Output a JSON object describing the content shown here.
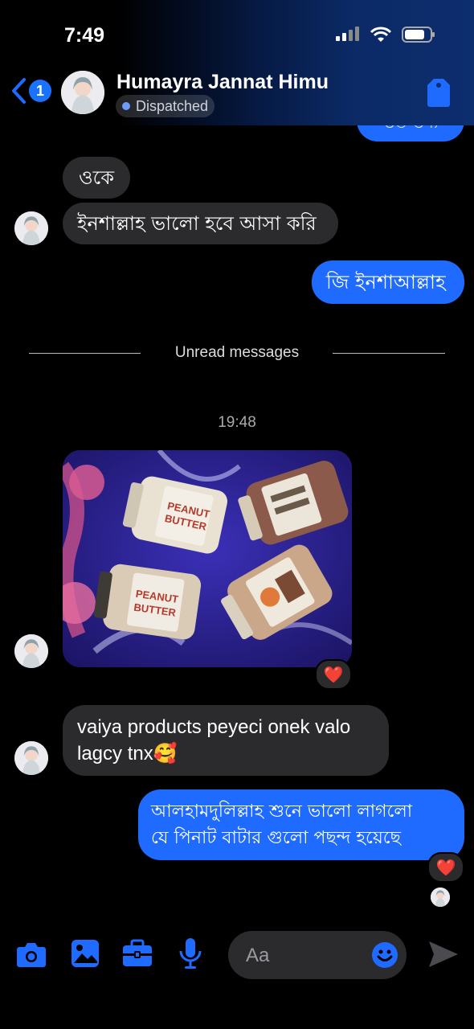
{
  "status": {
    "time": "7:49"
  },
  "header": {
    "back_count": "1",
    "contact_name": "Humayra Jannat Himu",
    "status_label": "Dispatched"
  },
  "messages": {
    "partial_top": "ভত ভন্য",
    "m1": "ওকে",
    "m2": "ইনশাল্লাহ ভালো হবে আসা করি",
    "m3": "জি ইনশাআল্লাহ",
    "unread_label": "Unread messages",
    "timestamp": "19:48",
    "m5_line1": "vaiya products peyeci onek valo",
    "m5_line2": "lagcy tnx🥰",
    "m6_line1": "আলহামদুলিল্লাহ শুনে ভালো লাগলো",
    "m6_line2": "যে পিনাট বাটার গুলো পছন্দ হয়েছে",
    "reaction": "❤️"
  },
  "photo": {
    "jar_label_1": "PEANUT BUTTER",
    "jar_label_2": "PEANUT BUTTER"
  },
  "composer": {
    "placeholder": "Aa"
  },
  "colors": {
    "accent": "#1f6bff",
    "incoming": "#2b2b2e",
    "background": "#000000"
  }
}
